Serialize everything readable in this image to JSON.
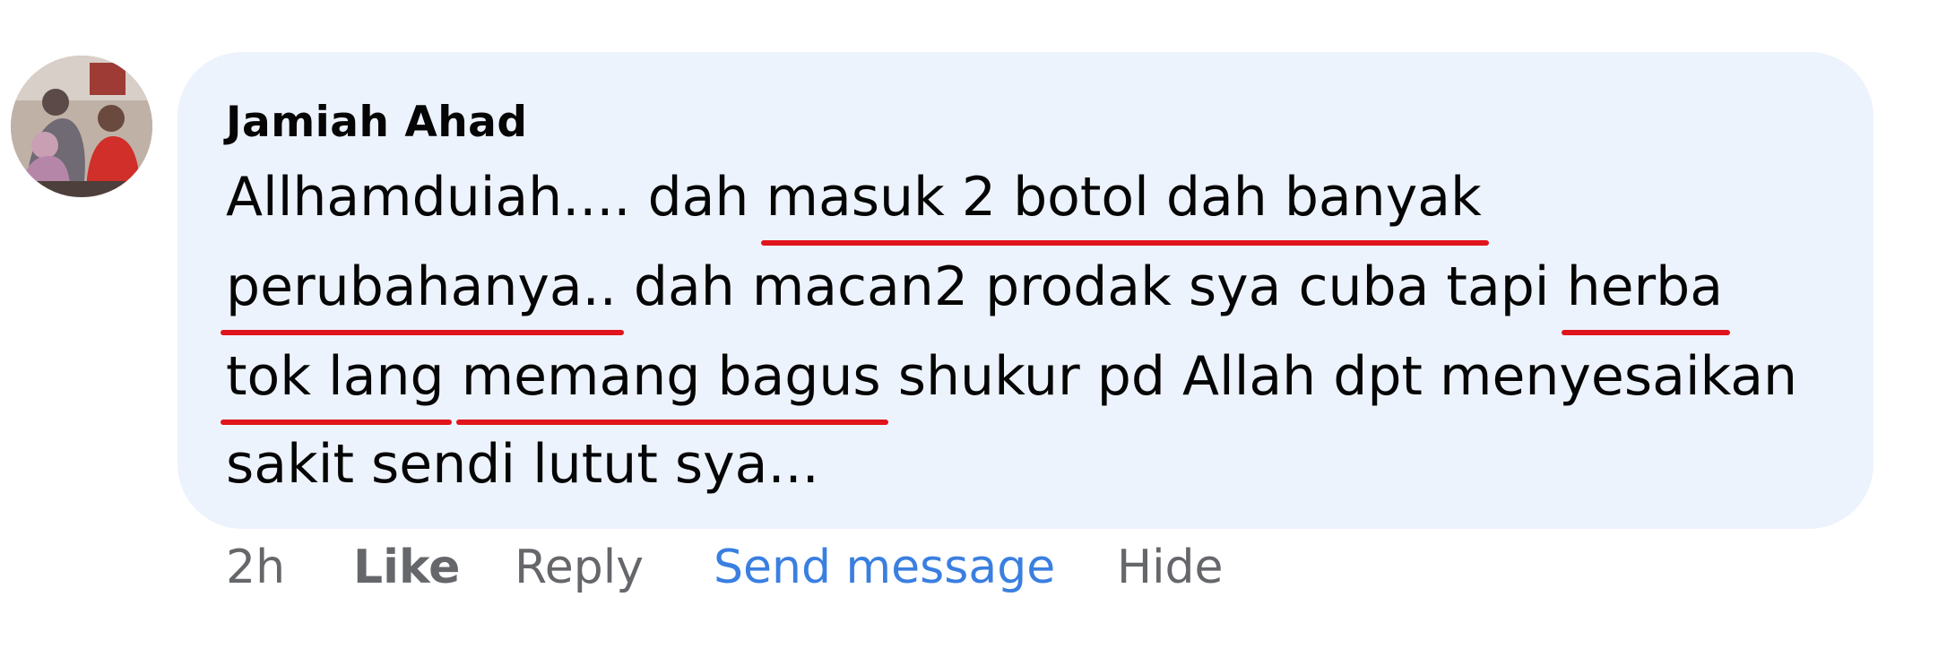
{
  "comment": {
    "author": "Jamiah Ahad",
    "text_lines": [
      {
        "before": "Allhamduiah.... dah ",
        "underlined": "masuk 2 botol dah banyak",
        "after": ""
      },
      {
        "before": "",
        "underlined": "perubahanya..",
        "after": " dah macan2 prodak sya cuba tapi ",
        "underlined2": "herba"
      },
      {
        "before": "",
        "underlined": "tok lang",
        "middle": " ",
        "underlined2": "memang bagus",
        "after": " shukur pd Allah dpt menyesaikan"
      },
      {
        "before": "sakit sendi lutut sya...",
        "underlined": "",
        "after": ""
      }
    ],
    "actions": {
      "time": "2h",
      "like": "Like",
      "reply": "Reply",
      "send_message": "Send message",
      "hide": "Hide"
    }
  },
  "colors": {
    "bubble_bg": "#edf3fc",
    "text": "#050505",
    "muted": "#65676b",
    "link": "#3a7fe0",
    "underline": "#e0141c"
  },
  "icons": {
    "avatar": "profile-photo"
  }
}
